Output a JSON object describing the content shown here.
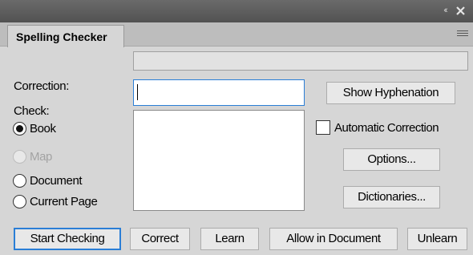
{
  "panel": {
    "tab_title": "Spelling Checker"
  },
  "form": {
    "correction_label": "Correction:",
    "correction_value": "",
    "check_label": "Check:",
    "check_options": [
      {
        "label": "Book",
        "selected": true,
        "enabled": true
      },
      {
        "label": "Map",
        "selected": false,
        "enabled": false
      },
      {
        "label": "Document",
        "selected": false,
        "enabled": true
      },
      {
        "label": "Current Page",
        "selected": false,
        "enabled": true
      }
    ],
    "suggestions": []
  },
  "side_buttons": {
    "show_hyphenation": "Show Hyphenation",
    "automatic_correction": "Automatic Correction",
    "automatic_correction_checked": false,
    "options": "Options...",
    "dictionaries": "Dictionaries..."
  },
  "bottom_buttons": {
    "start_checking": "Start Checking",
    "correct": "Correct",
    "learn": "Learn",
    "allow_in_document": "Allow in Document",
    "unlearn": "Unlearn"
  },
  "colors": {
    "accent": "#2a7ed6",
    "panel_bg": "#d6d6d6",
    "titlebar_bg": "#5e5e5e"
  },
  "icons": {
    "collapse": "double-chevron-left-icon",
    "close": "close-icon",
    "panel_menu": "hamburger-menu-icon"
  }
}
